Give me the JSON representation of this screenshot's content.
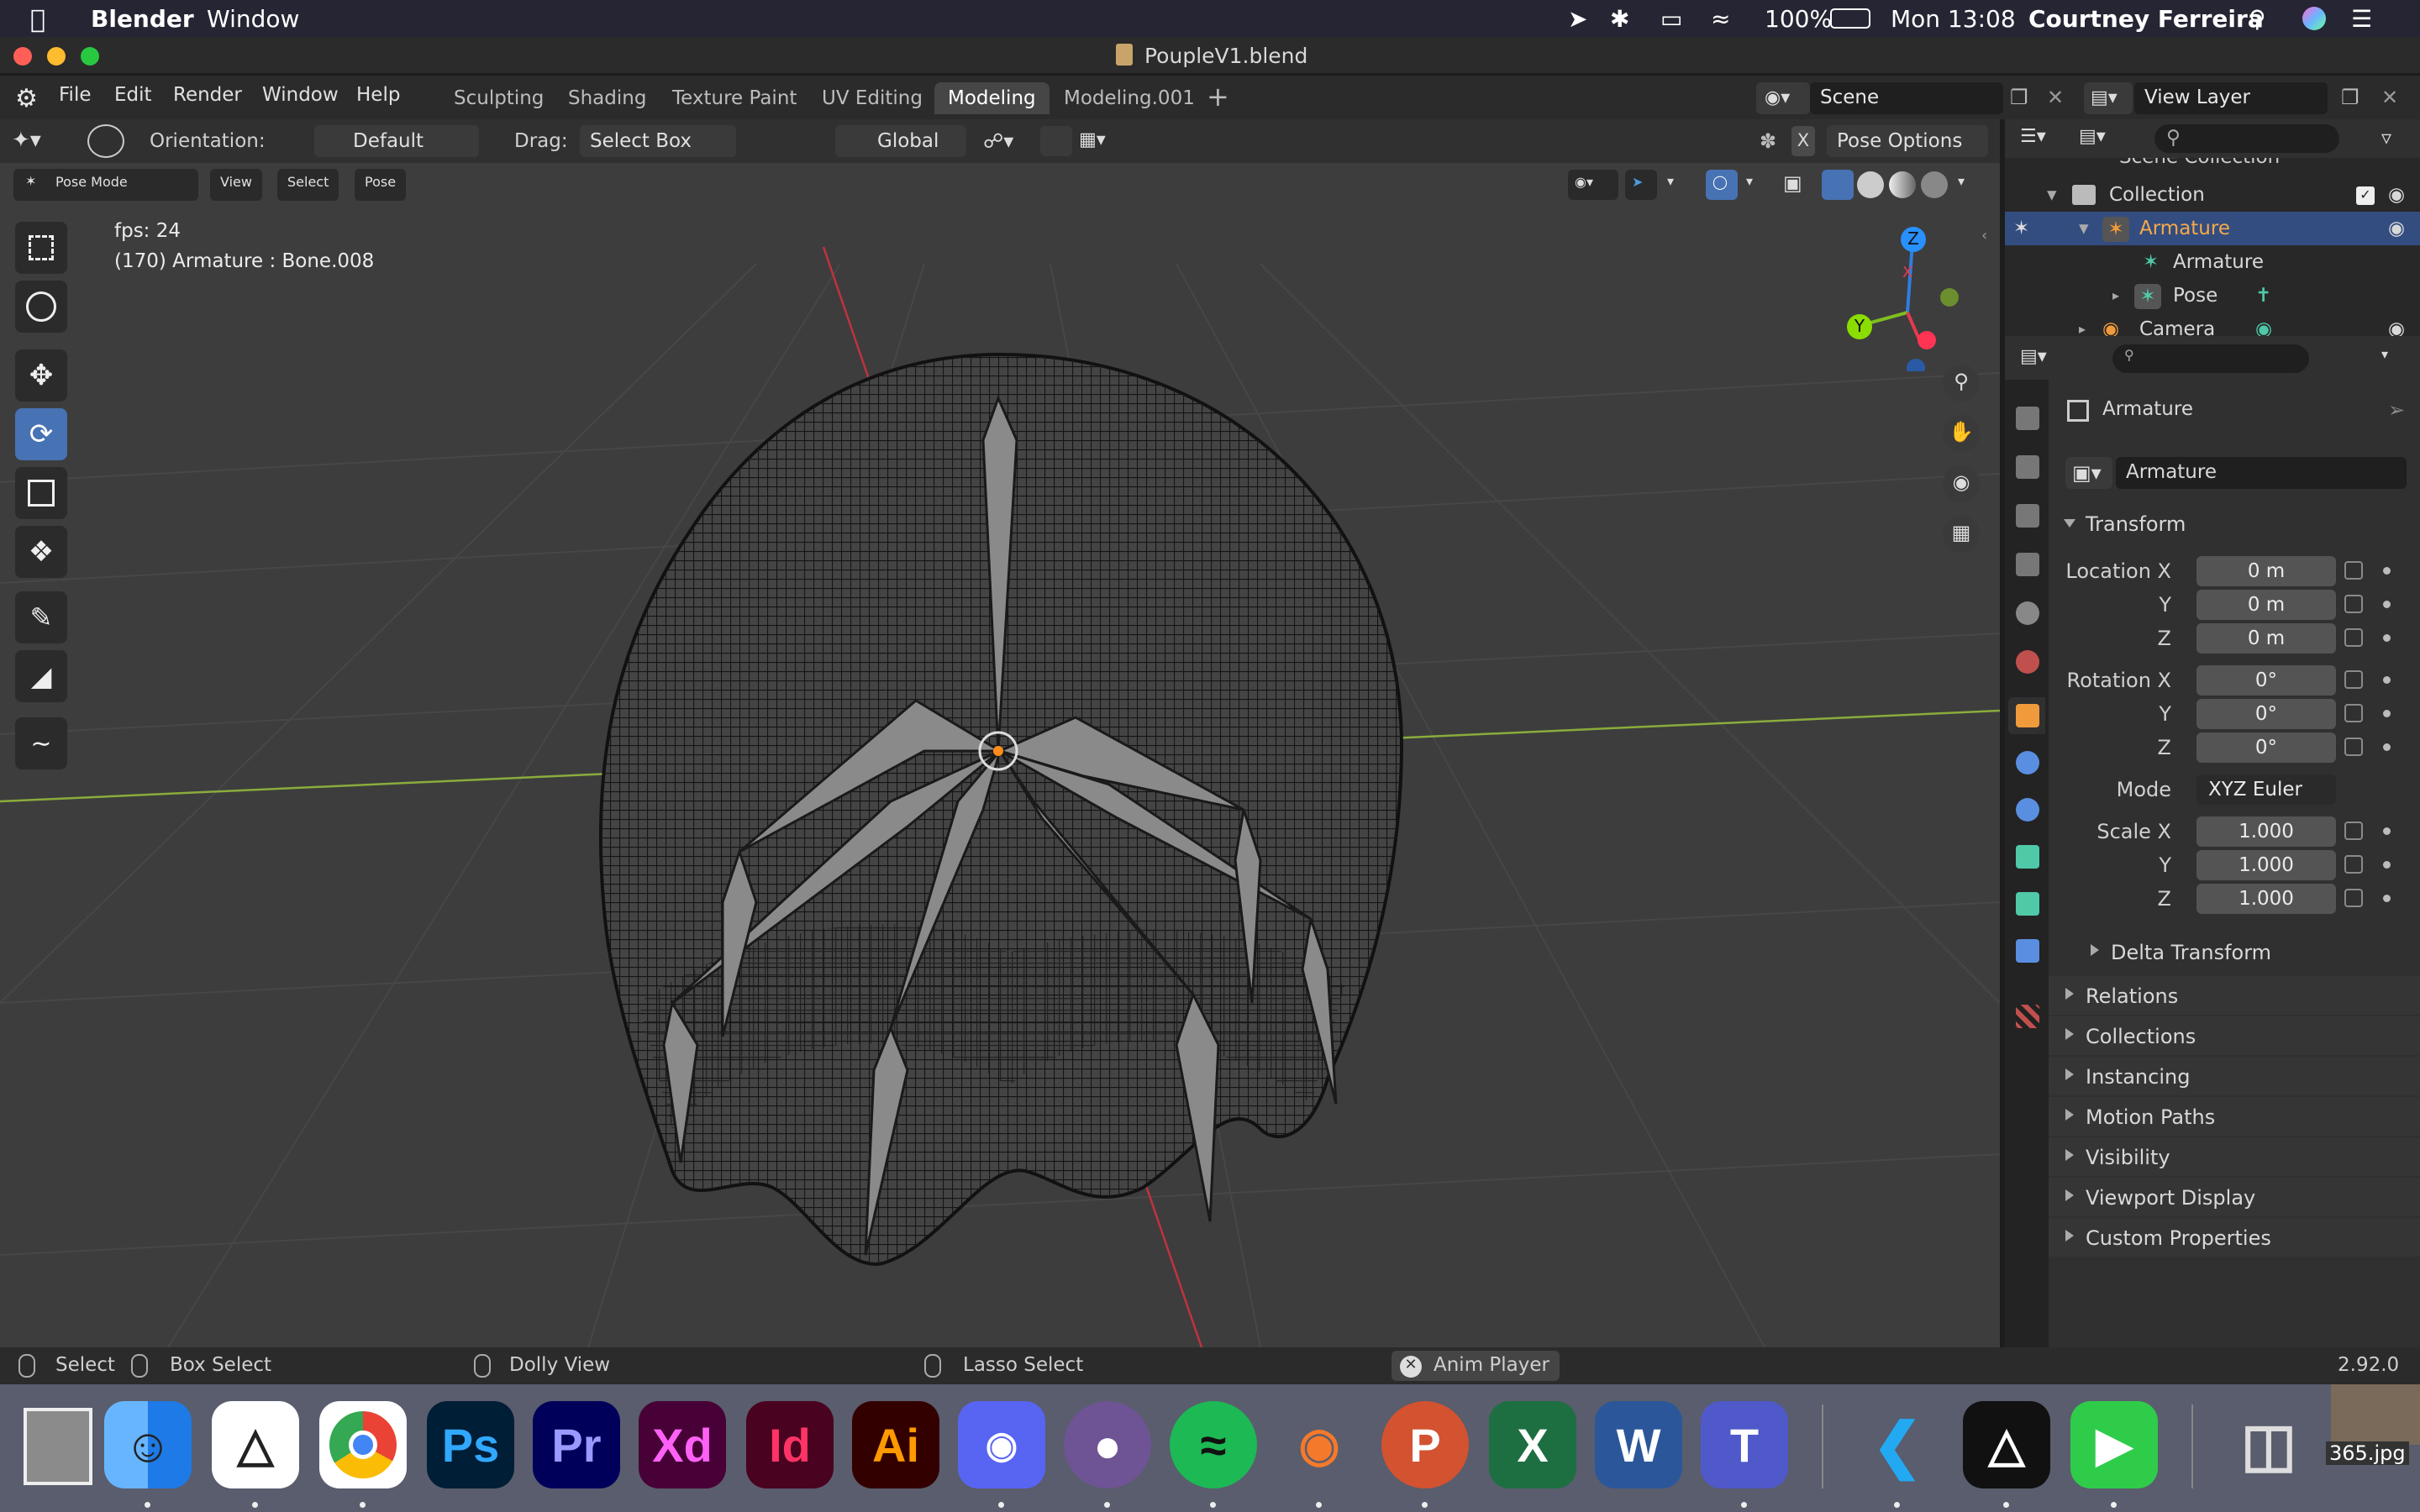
{
  "menubar": {
    "app_name": "Blender",
    "window_menu": "Window",
    "battery": "100%",
    "clock": "Mon 13:08",
    "user": "Courtney Ferreira"
  },
  "title": "PoupleV1.blend",
  "top_menu": [
    "File",
    "Edit",
    "Render",
    "Window",
    "Help"
  ],
  "workspace_tabs": [
    "Sculpting",
    "Shading",
    "Texture Paint",
    "UV Editing",
    "Modeling",
    "Modeling.001"
  ],
  "active_tab": "Modeling",
  "scene": "Scene",
  "view_layer": "View Layer",
  "tool_header": {
    "orientation_label": "Orientation:",
    "orientation_value": "Default",
    "drag_label": "Drag:",
    "drag_value": "Select Box",
    "transform_orientation": "Global",
    "pose_options": "Pose Options"
  },
  "viewport_header": {
    "mode": "Pose Mode",
    "menus": [
      "View",
      "Select",
      "Pose"
    ]
  },
  "overlay": {
    "fps": "fps: 24",
    "info": "(170) Armature : Bone.008"
  },
  "gizmo": {
    "z": "Z",
    "y": "Y",
    "x": "X"
  },
  "outliner": {
    "scene_collection": "Scene Collection",
    "collection": "Collection",
    "armature_obj": "Armature",
    "armature_data": "Armature",
    "pose": "Pose",
    "camera": "Camera"
  },
  "properties": {
    "object_name": "Armature",
    "datablock": "Armature",
    "transform_header": "Transform",
    "location_label": "Location X",
    "rotation_label": "Rotation X",
    "scale_label": "Scale X",
    "y": "Y",
    "z": "Z",
    "location": [
      "0 m",
      "0 m",
      "0 m"
    ],
    "rotation": [
      "0°",
      "0°",
      "0°"
    ],
    "mode_label": "Mode",
    "mode_value": "XYZ Euler",
    "scale": [
      "1.000",
      "1.000",
      "1.000"
    ],
    "delta_transform": "Delta Transform",
    "panels": [
      "Relations",
      "Collections",
      "Instancing",
      "Motion Paths",
      "Visibility",
      "Viewport Display",
      "Custom Properties"
    ]
  },
  "statusbar": {
    "select": "Select",
    "box_select": "Box Select",
    "dolly_view": "Dolly View",
    "lasso_select": "Lasso Select",
    "anim_player": "Anim Player",
    "version": "2.92.0"
  },
  "dock": {
    "apps": [
      "finder-icon",
      "unity-icon",
      "chrome-icon",
      "photoshop-icon",
      "premiere-icon",
      "xd-icon",
      "indesign-icon",
      "illustrator-icon",
      "discord-icon",
      "github-icon",
      "spotify-icon",
      "blender-icon",
      "powerpoint-icon",
      "excel-icon",
      "word-icon",
      "teams-icon",
      "vscode-icon",
      "unity-hub-icon",
      "facetime-icon",
      "trash-icon"
    ],
    "labels": {
      "ps": "Ps",
      "pr": "Pr",
      "xd": "Xd",
      "id": "Id",
      "ai": "Ai",
      "p": "P",
      "x": "X",
      "w": "W",
      "t": "T"
    },
    "file_label": "365.jpg"
  },
  "colors": {
    "accent": "#4772b3",
    "active_tab": "#464646",
    "x_axis": "#ff3352",
    "y_axis": "#8bdc00",
    "z_axis": "#2890ff"
  }
}
